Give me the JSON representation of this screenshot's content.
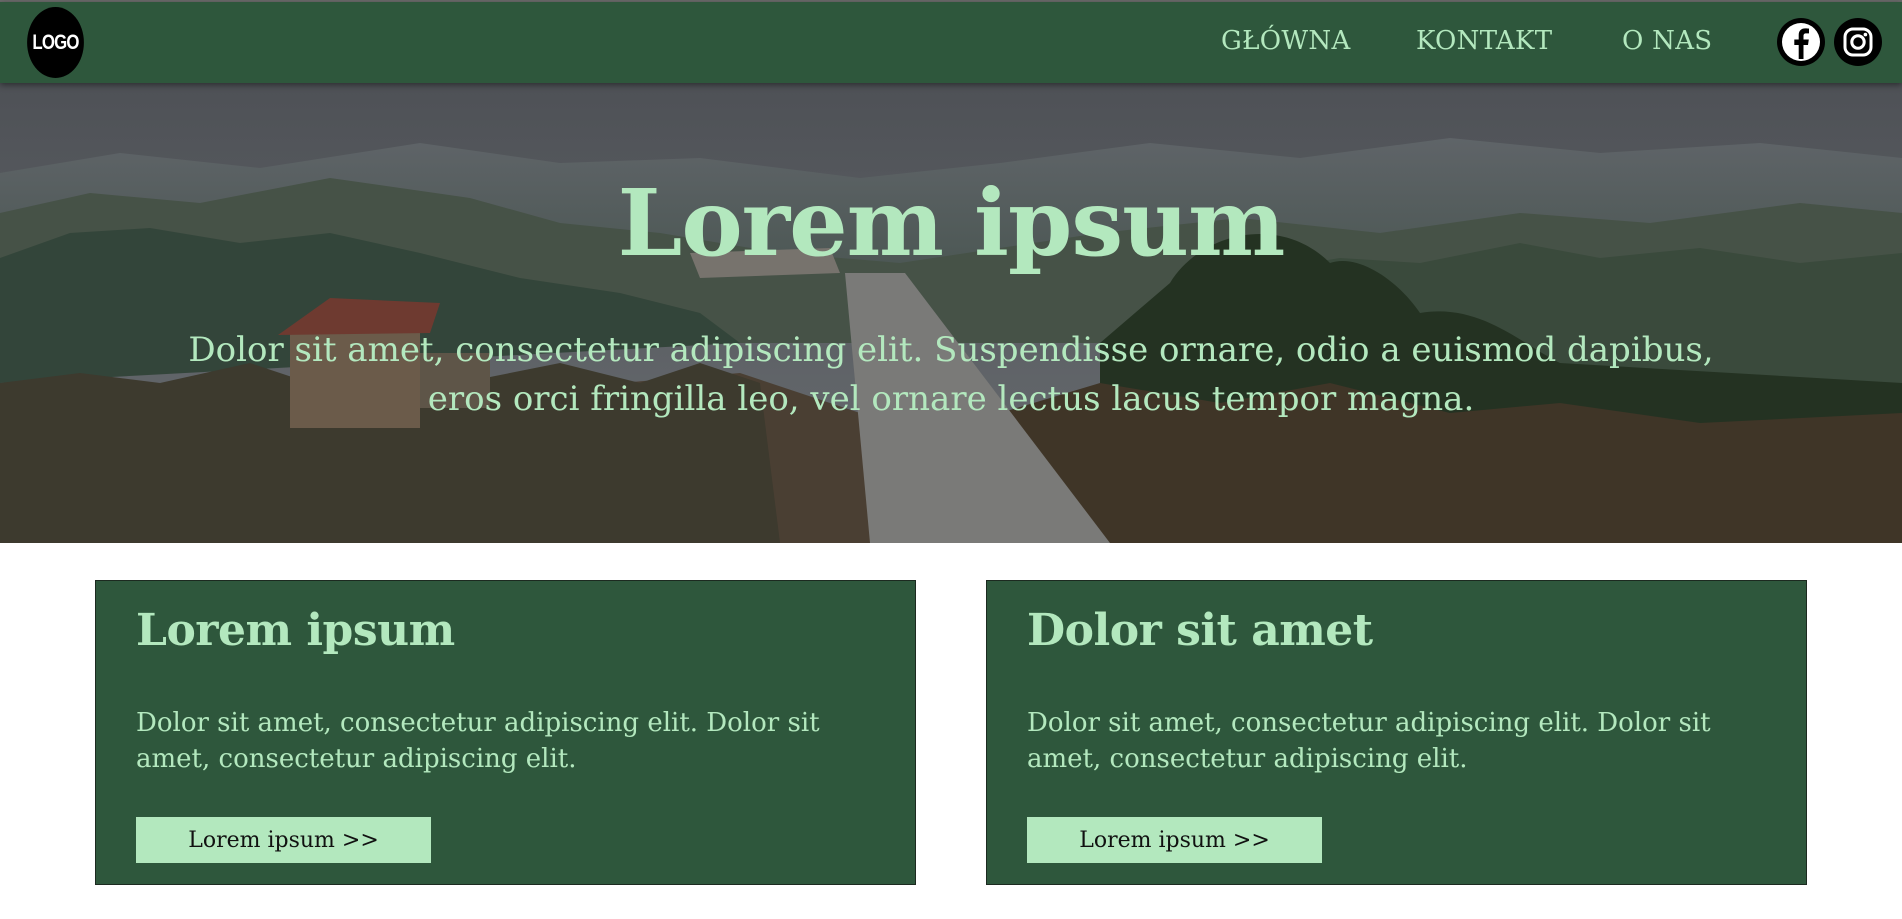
{
  "header": {
    "logo_text": "LOGO",
    "nav": [
      {
        "label": "GŁÓWNA"
      },
      {
        "label": "KONTAKT"
      },
      {
        "label": "O NAS"
      }
    ],
    "social": [
      {
        "icon": "facebook-icon"
      },
      {
        "icon": "instagram-icon"
      }
    ]
  },
  "hero": {
    "title": "Lorem ipsum",
    "text": "Dolor sit amet, consectetur adipiscing elit. Suspendisse ornare, odio a euismod dapibus, eros orci fringilla leo, vel ornare lectus lacus tempor magna."
  },
  "cards": [
    {
      "title": "Lorem ipsum",
      "text": "Dolor sit amet, consectetur adipiscing elit. Dolor sit amet, consectetur adipiscing elit.",
      "button": "Lorem ipsum >>"
    },
    {
      "title": "Dolor sit amet",
      "text": "Dolor sit amet, consectetur adipiscing elit. Dolor sit amet, consectetur adipiscing elit.",
      "button": "Lorem ipsum >>"
    }
  ],
  "colors": {
    "primary": "#2e573c",
    "accent": "#b3e8be",
    "background": "#ffffff"
  }
}
